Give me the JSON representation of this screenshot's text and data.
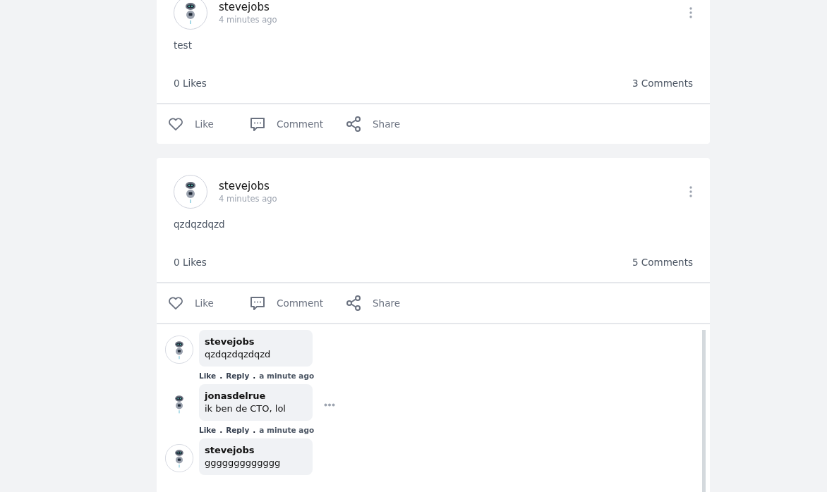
{
  "posts": [
    {
      "author": "stevejobs",
      "time": "4 minutes ago",
      "text": "test",
      "likes": "0 Likes",
      "comments_count": "3 Comments",
      "actions": [
        "Like",
        "Comment",
        "Share"
      ]
    },
    {
      "author": "stevejobs",
      "time": "4 minutes ago",
      "text": "qzdqzdqzd",
      "likes": "0 Likes",
      "comments_count": "5 Comments",
      "actions": [
        "Like",
        "Comment",
        "Share"
      ],
      "comments": [
        {
          "author": "stevejobs",
          "text": "qzdqzdqzdqzd",
          "avatar_ring": true,
          "more": false,
          "meta": [
            {
              "kind": "link",
              "text": "Like"
            },
            {
              "kind": "sep",
              "text": "."
            },
            {
              "kind": "link",
              "text": "Reply"
            },
            {
              "kind": "sep",
              "text": "."
            },
            {
              "kind": "time",
              "text": "a minute ago"
            }
          ]
        },
        {
          "author": "jonasdelrue",
          "text": "ik ben de CTO, lol",
          "avatar_ring": false,
          "more": true,
          "meta": [
            {
              "kind": "link",
              "text": "Like"
            },
            {
              "kind": "sep",
              "text": "."
            },
            {
              "kind": "link",
              "text": "Reply"
            },
            {
              "kind": "sep",
              "text": "."
            },
            {
              "kind": "time",
              "text": "a minute ago"
            }
          ]
        },
        {
          "author": "stevejobs",
          "text": "ggggggggggggg",
          "avatar_ring": true,
          "more": false
        }
      ]
    }
  ]
}
